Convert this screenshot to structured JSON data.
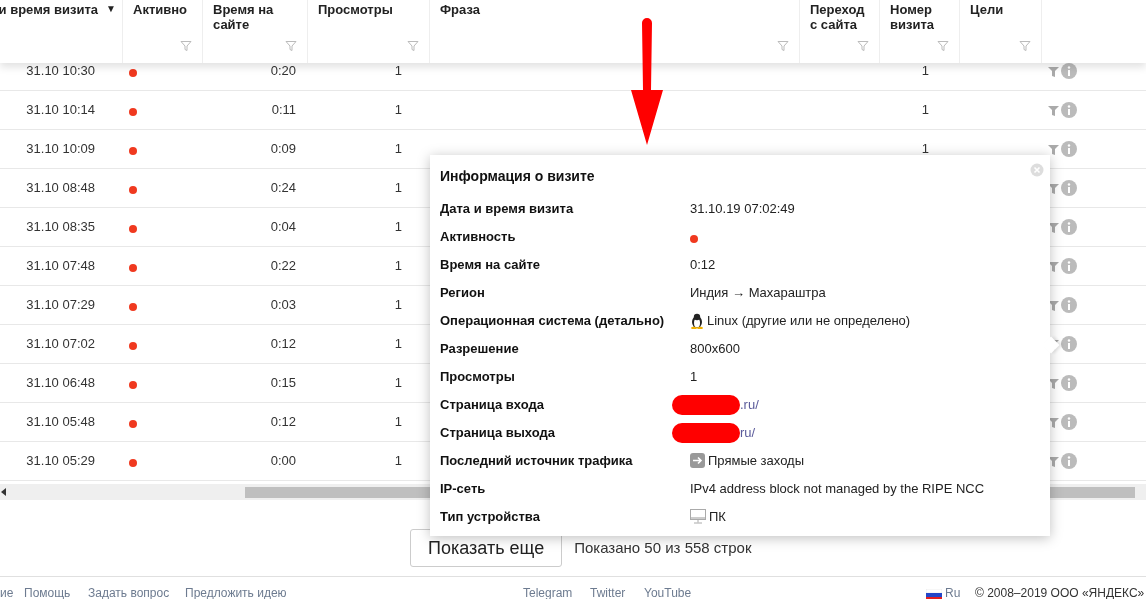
{
  "table": {
    "columns": [
      {
        "label": "и время визита",
        "sort": "▼"
      },
      {
        "label": "Активно"
      },
      {
        "label": "Время на сайте"
      },
      {
        "label": "Просмотры"
      },
      {
        "label": "Фраза"
      },
      {
        "label": "Переход с сайта"
      },
      {
        "label": "Номер визита"
      },
      {
        "label": "Цели"
      }
    ],
    "rows": [
      {
        "date": "31.10 10:30",
        "color": "#f0391f",
        "time": "0:20",
        "views": "1",
        "visit": "1"
      },
      {
        "date": "31.10 10:14",
        "color": "#f0391f",
        "time": "0:11",
        "views": "1",
        "visit": "1"
      },
      {
        "date": "31.10 10:09",
        "color": "#f0391f",
        "time": "0:09",
        "views": "1",
        "visit": "1"
      },
      {
        "date": "31.10 08:48",
        "color": "#f0391f",
        "time": "0:24",
        "views": "1"
      },
      {
        "date": "31.10 08:35",
        "color": "#f0391f",
        "time": "0:04",
        "views": "1"
      },
      {
        "date": "31.10 07:48",
        "color": "#f0391f",
        "time": "0:22",
        "views": "1"
      },
      {
        "date": "31.10 07:29",
        "color": "#f0391f",
        "time": "0:03",
        "views": "1"
      },
      {
        "date": "31.10 07:02",
        "color": "#f0391f",
        "time": "0:12",
        "views": "1"
      },
      {
        "date": "31.10 06:48",
        "color": "#f0391f",
        "time": "0:15",
        "views": "1"
      },
      {
        "date": "31.10 05:48",
        "color": "#f0391f",
        "time": "0:12",
        "views": "1"
      },
      {
        "date": "31.10 05:29",
        "color": "#f0391f",
        "time": "0:00",
        "views": "1"
      }
    ]
  },
  "show_more": {
    "button": "Показать еще",
    "summary": "Показано 50 из 558 строк"
  },
  "popup": {
    "title": "Информация о визите",
    "fields": [
      {
        "kind": "text",
        "label": "Дата и время визита",
        "value": "31.10.19 07:02:49"
      },
      {
        "kind": "dot",
        "label": "Активность",
        "color": "#f0391f"
      },
      {
        "kind": "text",
        "label": "Время на сайте",
        "value": "0:12"
      },
      {
        "kind": "text",
        "label": "Регион",
        "value": "Индия → Махараштра"
      },
      {
        "kind": "os",
        "label": "Операционная система (детально)",
        "value": "Linux (другие или не определено)"
      },
      {
        "kind": "text",
        "label": "Разрешение",
        "value": "800x600"
      },
      {
        "kind": "text",
        "label": "Просмотры",
        "value": "1"
      },
      {
        "kind": "link",
        "label": "Страница входа",
        "value": ".ru/"
      },
      {
        "kind": "link",
        "label": "Страница выхода",
        "value": "ru/"
      },
      {
        "kind": "source",
        "label": "Последний источник трафика",
        "value": "Прямые заходы"
      },
      {
        "kind": "text",
        "label": "IP-сеть",
        "value": "IPv4 address block not managed by the RIPE NCC"
      },
      {
        "kind": "device",
        "label": "Тип устройства",
        "value": "ПК"
      }
    ]
  },
  "footer": {
    "left_links": [
      "ие",
      "Помощь",
      "Задать вопрос",
      "Предложить идею"
    ],
    "social_links": [
      "Telegram",
      "Twitter",
      "YouTube"
    ],
    "language": "Ru",
    "copyright": "© 2008–2019 ООО «ЯНДЕКС»"
  }
}
